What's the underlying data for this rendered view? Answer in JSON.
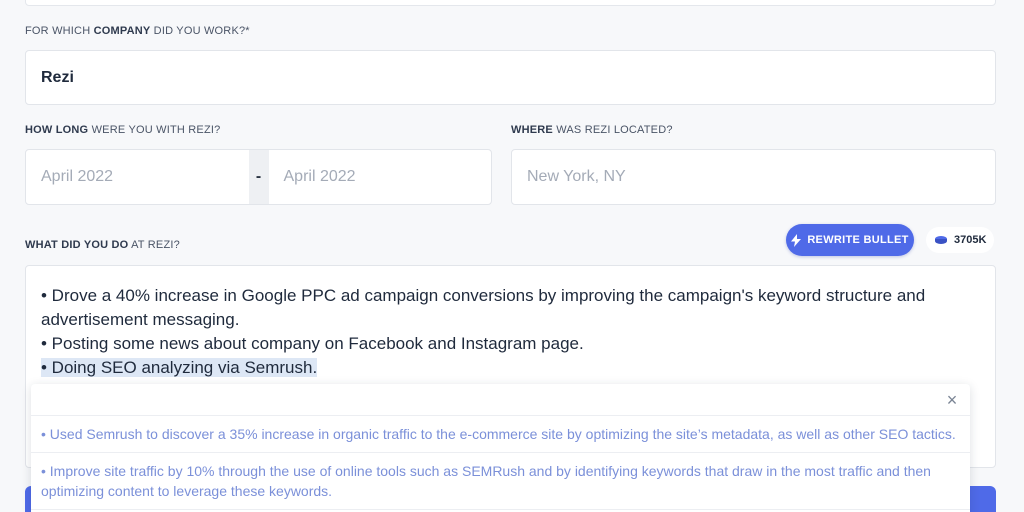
{
  "company": {
    "label_prefix": "FOR WHICH ",
    "label_bold": "COMPANY",
    "label_suffix": " DID YOU WORK?*",
    "value": "Rezi"
  },
  "duration": {
    "label_bold": "HOW LONG",
    "label_suffix": " WERE YOU WITH REZI?",
    "start_placeholder": "April 2022",
    "separator": "-",
    "end_placeholder": "April 2022"
  },
  "location": {
    "label_bold": "WHERE",
    "label_suffix": " WAS REZI LOCATED?",
    "placeholder": "New York, NY"
  },
  "description": {
    "label_bold": "WHAT DID YOU DO",
    "label_suffix": " AT REZI?",
    "lines": [
      "• Drove a 40% increase in Google PPC ad campaign conversions by improving the campaign's keyword structure and advertisement messaging.",
      "• Posting some news about company on Facebook and Instagram page.",
      "• Doing SEO analyzing via Semrush."
    ]
  },
  "rewrite_button": {
    "label": "REWRITE BULLET",
    "icon": "lightning-icon"
  },
  "tokens": {
    "value": "3705K",
    "icon": "coin-icon"
  },
  "suggestions": {
    "close_icon": "×",
    "items": [
      "• Used Semrush to discover a 35% increase in organic traffic to the e-commerce site by optimizing the site’s metadata, as well as other SEO tactics.",
      "• Improve site traffic by 10% through the use of online tools such as SEMRush and by identifying keywords that draw in the most traffic and then optimizing content to leverage these keywords."
    ]
  },
  "colors": {
    "accent": "#4f6ae8",
    "suggestion_text": "#7b90d9",
    "placeholder": "#a4abb7"
  }
}
